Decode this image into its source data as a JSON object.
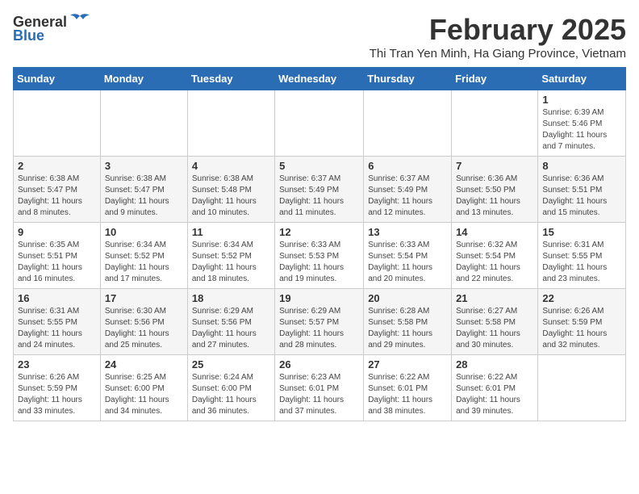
{
  "logo": {
    "general": "General",
    "blue": "Blue"
  },
  "title": "February 2025",
  "location": "Thi Tran Yen Minh, Ha Giang Province, Vietnam",
  "days_of_week": [
    "Sunday",
    "Monday",
    "Tuesday",
    "Wednesday",
    "Thursday",
    "Friday",
    "Saturday"
  ],
  "weeks": [
    [
      {
        "day": "",
        "info": ""
      },
      {
        "day": "",
        "info": ""
      },
      {
        "day": "",
        "info": ""
      },
      {
        "day": "",
        "info": ""
      },
      {
        "day": "",
        "info": ""
      },
      {
        "day": "",
        "info": ""
      },
      {
        "day": "1",
        "info": "Sunrise: 6:39 AM\nSunset: 5:46 PM\nDaylight: 11 hours\nand 7 minutes."
      }
    ],
    [
      {
        "day": "2",
        "info": "Sunrise: 6:38 AM\nSunset: 5:47 PM\nDaylight: 11 hours\nand 8 minutes."
      },
      {
        "day": "3",
        "info": "Sunrise: 6:38 AM\nSunset: 5:47 PM\nDaylight: 11 hours\nand 9 minutes."
      },
      {
        "day": "4",
        "info": "Sunrise: 6:38 AM\nSunset: 5:48 PM\nDaylight: 11 hours\nand 10 minutes."
      },
      {
        "day": "5",
        "info": "Sunrise: 6:37 AM\nSunset: 5:49 PM\nDaylight: 11 hours\nand 11 minutes."
      },
      {
        "day": "6",
        "info": "Sunrise: 6:37 AM\nSunset: 5:49 PM\nDaylight: 11 hours\nand 12 minutes."
      },
      {
        "day": "7",
        "info": "Sunrise: 6:36 AM\nSunset: 5:50 PM\nDaylight: 11 hours\nand 13 minutes."
      },
      {
        "day": "8",
        "info": "Sunrise: 6:36 AM\nSunset: 5:51 PM\nDaylight: 11 hours\nand 15 minutes."
      }
    ],
    [
      {
        "day": "9",
        "info": "Sunrise: 6:35 AM\nSunset: 5:51 PM\nDaylight: 11 hours\nand 16 minutes."
      },
      {
        "day": "10",
        "info": "Sunrise: 6:34 AM\nSunset: 5:52 PM\nDaylight: 11 hours\nand 17 minutes."
      },
      {
        "day": "11",
        "info": "Sunrise: 6:34 AM\nSunset: 5:52 PM\nDaylight: 11 hours\nand 18 minutes."
      },
      {
        "day": "12",
        "info": "Sunrise: 6:33 AM\nSunset: 5:53 PM\nDaylight: 11 hours\nand 19 minutes."
      },
      {
        "day": "13",
        "info": "Sunrise: 6:33 AM\nSunset: 5:54 PM\nDaylight: 11 hours\nand 20 minutes."
      },
      {
        "day": "14",
        "info": "Sunrise: 6:32 AM\nSunset: 5:54 PM\nDaylight: 11 hours\nand 22 minutes."
      },
      {
        "day": "15",
        "info": "Sunrise: 6:31 AM\nSunset: 5:55 PM\nDaylight: 11 hours\nand 23 minutes."
      }
    ],
    [
      {
        "day": "16",
        "info": "Sunrise: 6:31 AM\nSunset: 5:55 PM\nDaylight: 11 hours\nand 24 minutes."
      },
      {
        "day": "17",
        "info": "Sunrise: 6:30 AM\nSunset: 5:56 PM\nDaylight: 11 hours\nand 25 minutes."
      },
      {
        "day": "18",
        "info": "Sunrise: 6:29 AM\nSunset: 5:56 PM\nDaylight: 11 hours\nand 27 minutes."
      },
      {
        "day": "19",
        "info": "Sunrise: 6:29 AM\nSunset: 5:57 PM\nDaylight: 11 hours\nand 28 minutes."
      },
      {
        "day": "20",
        "info": "Sunrise: 6:28 AM\nSunset: 5:58 PM\nDaylight: 11 hours\nand 29 minutes."
      },
      {
        "day": "21",
        "info": "Sunrise: 6:27 AM\nSunset: 5:58 PM\nDaylight: 11 hours\nand 30 minutes."
      },
      {
        "day": "22",
        "info": "Sunrise: 6:26 AM\nSunset: 5:59 PM\nDaylight: 11 hours\nand 32 minutes."
      }
    ],
    [
      {
        "day": "23",
        "info": "Sunrise: 6:26 AM\nSunset: 5:59 PM\nDaylight: 11 hours\nand 33 minutes."
      },
      {
        "day": "24",
        "info": "Sunrise: 6:25 AM\nSunset: 6:00 PM\nDaylight: 11 hours\nand 34 minutes."
      },
      {
        "day": "25",
        "info": "Sunrise: 6:24 AM\nSunset: 6:00 PM\nDaylight: 11 hours\nand 36 minutes."
      },
      {
        "day": "26",
        "info": "Sunrise: 6:23 AM\nSunset: 6:01 PM\nDaylight: 11 hours\nand 37 minutes."
      },
      {
        "day": "27",
        "info": "Sunrise: 6:22 AM\nSunset: 6:01 PM\nDaylight: 11 hours\nand 38 minutes."
      },
      {
        "day": "28",
        "info": "Sunrise: 6:22 AM\nSunset: 6:01 PM\nDaylight: 11 hours\nand 39 minutes."
      },
      {
        "day": "",
        "info": ""
      }
    ]
  ]
}
